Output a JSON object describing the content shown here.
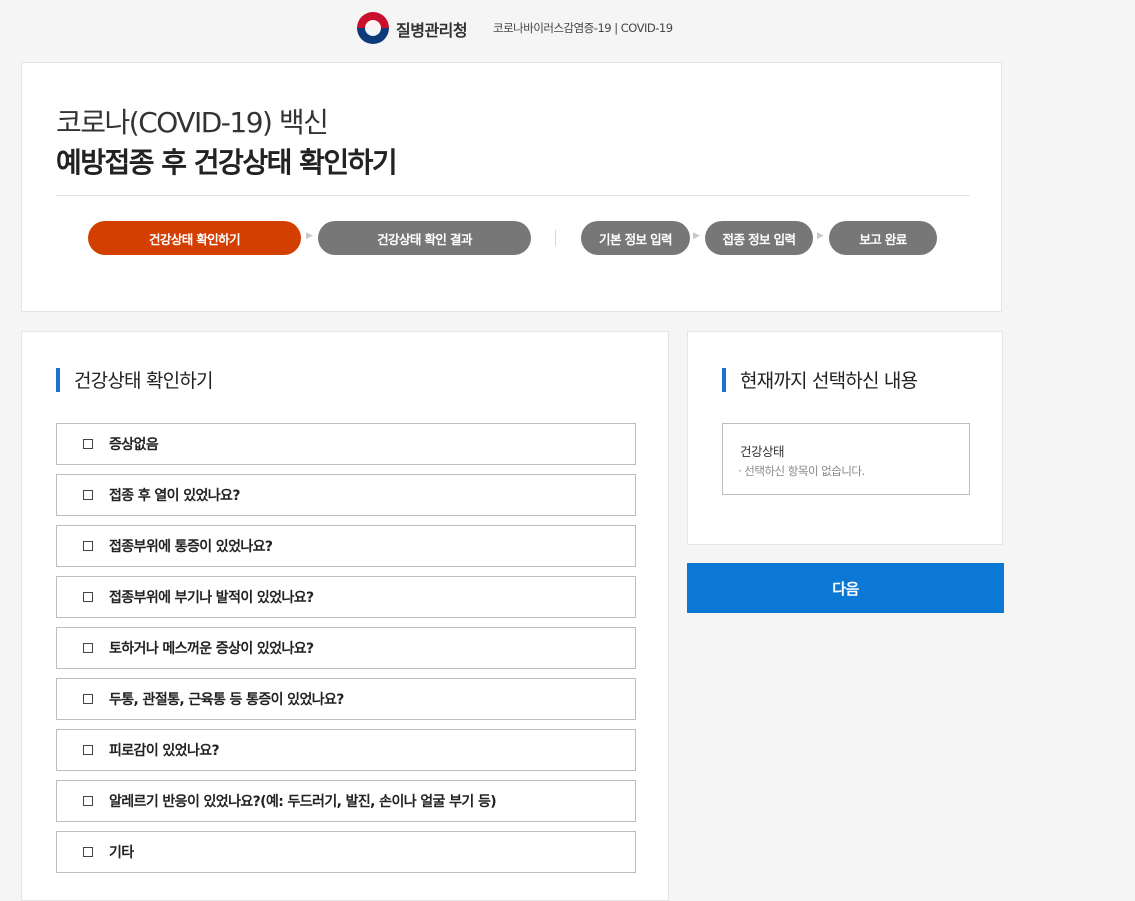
{
  "header": {
    "org_name": "질병관리청",
    "org_sub": "코로나바이러스감염증-19 | COVID-19"
  },
  "hero": {
    "title_line1": "코로나(COVID-19) 백신",
    "title_line2": "예방접종 후 건강상태 확인하기",
    "steps": [
      {
        "label": "건강상태 확인하기",
        "active": true
      },
      {
        "label": "건강상태 확인 결과",
        "active": false
      },
      {
        "label": "기본 정보 입력",
        "active": false
      },
      {
        "label": "접종 정보 입력",
        "active": false
      },
      {
        "label": "보고 완료",
        "active": false
      }
    ],
    "arrow_glyph": "▶"
  },
  "questions": {
    "heading": "건강상태 확인하기",
    "items": [
      "증상없음",
      "접종 후 열이 있었나요?",
      "접종부위에 통증이 있었나요?",
      "접종부위에 부기나 발적이 있었나요?",
      "토하거나 메스꺼운 증상이 있었나요?",
      "두통, 관절통, 근육통 등 통증이 있었나요?",
      "피로감이 있었나요?",
      "알레르기 반응이 있었나요?(예: 두드러기, 발진, 손이나 얼굴 부기 등)",
      "기타"
    ]
  },
  "summary": {
    "heading": "현재까지 선택하신 내용",
    "box_title": "건강상태",
    "empty_text": "· 선택하신 항목이 없습니다."
  },
  "actions": {
    "next_label": "다음"
  },
  "colors": {
    "accent_active": "#d23f00",
    "step_inactive": "#777777",
    "primary_button": "#0b78d6",
    "section_bar": "#1a73d1"
  }
}
